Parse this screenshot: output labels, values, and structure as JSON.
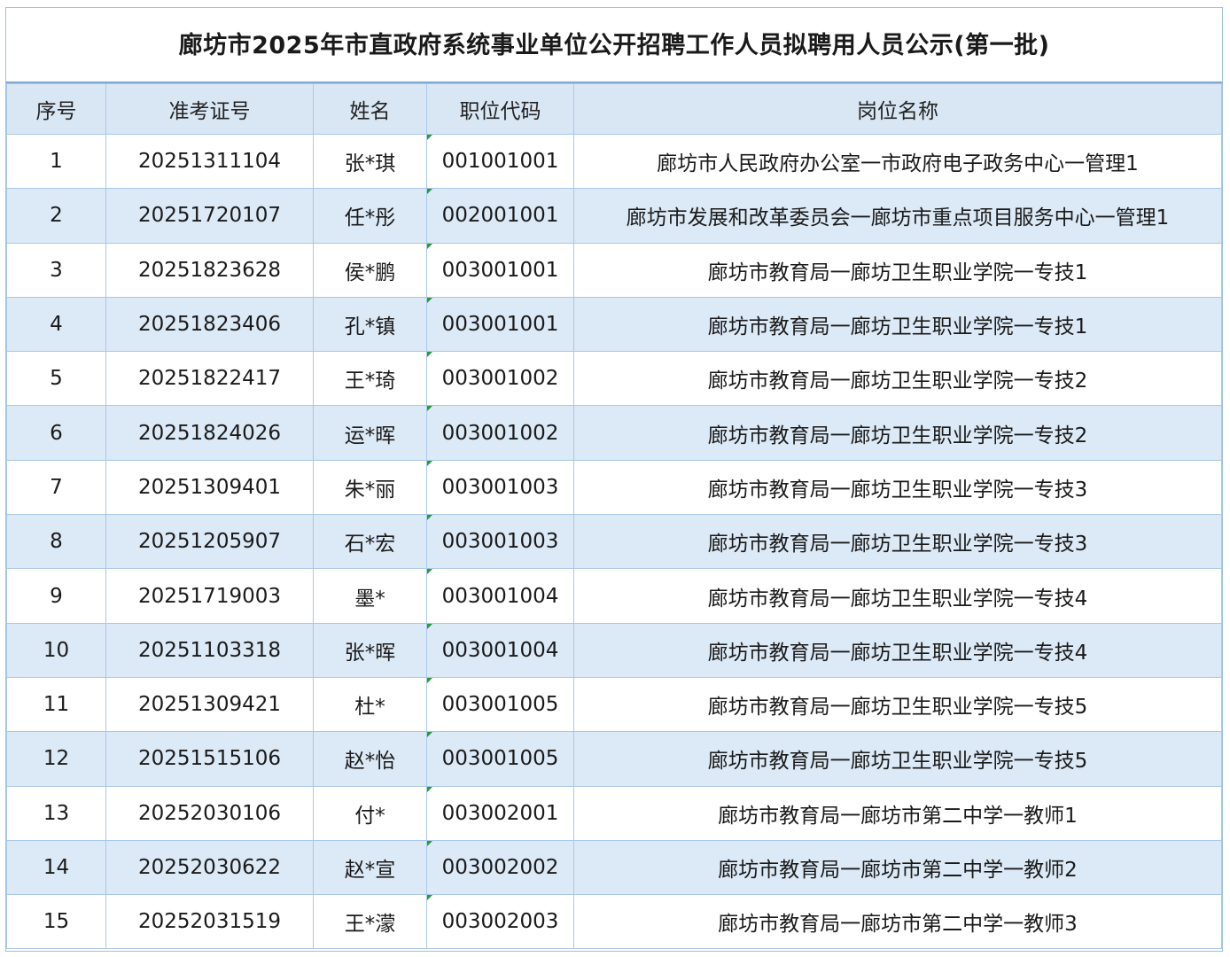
{
  "title": "廊坊市2025年市直政府系统事业单位公开招聘工作人员拟聘用人员公示(第一批)",
  "headers": {
    "seq": "序号",
    "exam_id": "准考证号",
    "name": "姓名",
    "code": "职位代码",
    "post": "岗位名称"
  },
  "rows": [
    {
      "seq": "1",
      "exam_id": "20251311104",
      "name": "张*琪",
      "code": "001001001",
      "post": "廊坊市人民政府办公室一市政府电子政务中心一管理1"
    },
    {
      "seq": "2",
      "exam_id": "20251720107",
      "name": "任*彤",
      "code": "002001001",
      "post": "廊坊市发展和改革委员会一廊坊市重点项目服务中心一管理1"
    },
    {
      "seq": "3",
      "exam_id": "20251823628",
      "name": "侯*鹏",
      "code": "003001001",
      "post": "廊坊市教育局一廊坊卫生职业学院一专技1"
    },
    {
      "seq": "4",
      "exam_id": "20251823406",
      "name": "孔*镇",
      "code": "003001001",
      "post": "廊坊市教育局一廊坊卫生职业学院一专技1"
    },
    {
      "seq": "5",
      "exam_id": "20251822417",
      "name": "王*琦",
      "code": "003001002",
      "post": "廊坊市教育局一廊坊卫生职业学院一专技2"
    },
    {
      "seq": "6",
      "exam_id": "20251824026",
      "name": "运*晖",
      "code": "003001002",
      "post": "廊坊市教育局一廊坊卫生职业学院一专技2"
    },
    {
      "seq": "7",
      "exam_id": "20251309401",
      "name": "朱*丽",
      "code": "003001003",
      "post": "廊坊市教育局一廊坊卫生职业学院一专技3"
    },
    {
      "seq": "8",
      "exam_id": "20251205907",
      "name": "石*宏",
      "code": "003001003",
      "post": "廊坊市教育局一廊坊卫生职业学院一专技3"
    },
    {
      "seq": "9",
      "exam_id": "20251719003",
      "name": "墨*",
      "code": "003001004",
      "post": "廊坊市教育局一廊坊卫生职业学院一专技4"
    },
    {
      "seq": "10",
      "exam_id": "20251103318",
      "name": "张*晖",
      "code": "003001004",
      "post": "廊坊市教育局一廊坊卫生职业学院一专技4"
    },
    {
      "seq": "11",
      "exam_id": "20251309421",
      "name": "杜*",
      "code": "003001005",
      "post": "廊坊市教育局一廊坊卫生职业学院一专技5"
    },
    {
      "seq": "12",
      "exam_id": "20251515106",
      "name": "赵*怡",
      "code": "003001005",
      "post": "廊坊市教育局一廊坊卫生职业学院一专技5"
    },
    {
      "seq": "13",
      "exam_id": "20252030106",
      "name": "付*",
      "code": "003002001",
      "post": "廊坊市教育局一廊坊市第二中学一教师1"
    },
    {
      "seq": "14",
      "exam_id": "20252030622",
      "name": "赵*宣",
      "code": "003002002",
      "post": "廊坊市教育局一廊坊市第二中学一教师2"
    },
    {
      "seq": "15",
      "exam_id": "20252031519",
      "name": "王*濛",
      "code": "003002003",
      "post": "廊坊市教育局一廊坊市第二中学一教师3"
    }
  ],
  "colors": {
    "header_bg": "#d9e7f5",
    "alt_row_bg": "#dce9f6",
    "border": "#a9c8e6",
    "cell_marker": "#1f9d3a"
  }
}
